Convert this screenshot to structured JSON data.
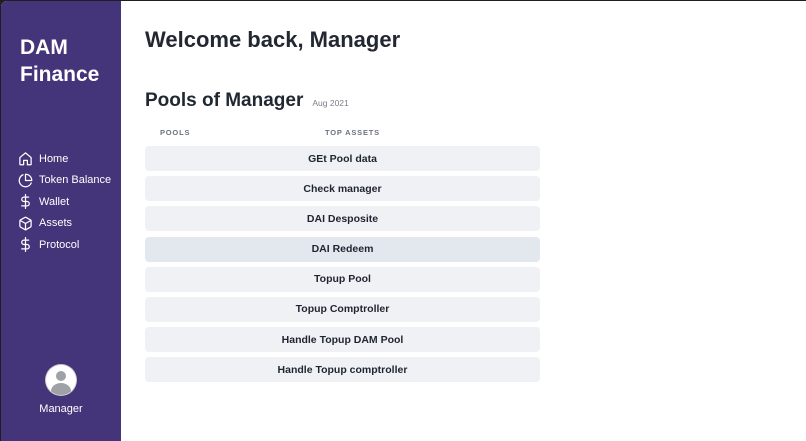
{
  "sidebar": {
    "brand": "DAM Finance",
    "items": [
      {
        "label": "Home",
        "icon": "home-icon"
      },
      {
        "label": "Token Balance",
        "icon": "pie-chart-icon"
      },
      {
        "label": "Wallet",
        "icon": "dollar-icon"
      },
      {
        "label": "Assets",
        "icon": "cube-icon"
      },
      {
        "label": "Protocol",
        "icon": "dollar-icon"
      }
    ],
    "user": {
      "name": "Manager",
      "icon": "avatar-icon"
    }
  },
  "main": {
    "welcome": "Welcome back, Manager",
    "pools": {
      "title": "Pools of Manager",
      "date": "Aug 2021",
      "columns": [
        "POOLS",
        "TOP ASSETS"
      ],
      "actions": [
        "GEt Pool data",
        "Check manager",
        "DAI Desposite",
        "DAI Redeem",
        "Topup Pool",
        "Topup Comptroller",
        "Handle Topup DAM Pool",
        "Handle Topup comptroller"
      ]
    }
  },
  "colors": {
    "sidebar_bg": "#443479",
    "button_bg": "#eff1f5",
    "button_hover_bg": "#e3e7ee",
    "text_dark": "#222831"
  }
}
